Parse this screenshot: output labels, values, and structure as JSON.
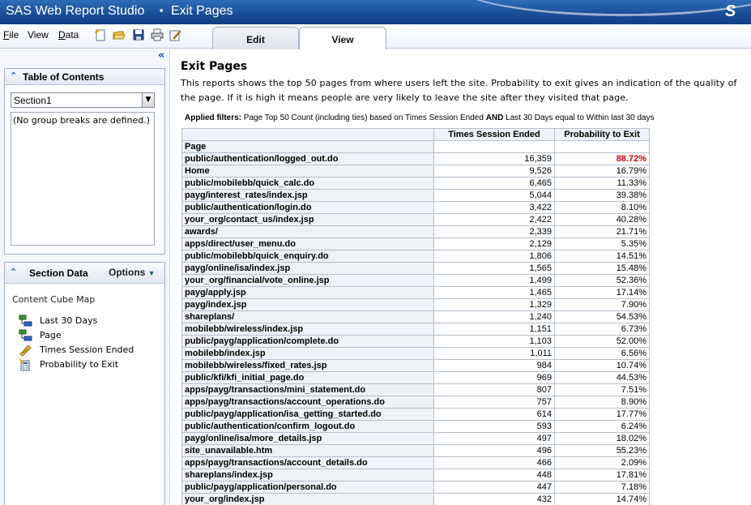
{
  "app": {
    "title": "SAS Web Report Studio",
    "separator": "•",
    "page_name": "Exit Pages",
    "logo": "S"
  },
  "menu": {
    "file_u": "F",
    "file_rest": "ile",
    "view_u": "V",
    "view_rest": "iew",
    "data_u": "D",
    "data_rest": "ata"
  },
  "toolbar_icons": [
    "new-report-icon",
    "open-icon",
    "save-icon",
    "print-icon",
    "edit-properties-icon"
  ],
  "tabs": {
    "edit": "Edit",
    "view": "View"
  },
  "left": {
    "collapse_glyph": "«",
    "toc": {
      "title": "Table of Contents",
      "selected_section": "Section1",
      "empty_message": "(No group breaks are defined.)"
    },
    "section_data": {
      "title": "Section Data",
      "options_label": "Options",
      "cube_map_label": "Content Cube Map",
      "items": [
        {
          "label": "Last 30 Days",
          "icon": "hierarchy-icon"
        },
        {
          "label": "Page",
          "icon": "hierarchy-icon"
        },
        {
          "label": "Times Session Ended",
          "icon": "measure-icon"
        },
        {
          "label": "Probability to Exit",
          "icon": "calculated-measure-icon"
        }
      ]
    }
  },
  "report": {
    "title": "Exit Pages",
    "description": "This reports shows the top 50 pages from where users left the site. Probability to exit gives an indication of the quality of the page. If it is high it means people are very likely to leave the site after they visited that page.",
    "filters": {
      "label": "Applied filters:",
      "text1": "Page Top 50 Count (including ties) based on Times Session Ended",
      "and": "AND",
      "text2": "Last 30 Days equal to Within last 30 days"
    },
    "columns": [
      "Times Session Ended",
      "Probability to Exit"
    ],
    "row_header": "Page",
    "highlight_color": "#cc0000",
    "rows": [
      [
        "public/authentication/logged_out.do",
        "16,359",
        "88.72%"
      ],
      [
        "Home",
        "9,526",
        "16.79%"
      ],
      [
        "public/mobilebb/quick_calc.do",
        "6,465",
        "11.33%"
      ],
      [
        "payg/interest_rates/index.jsp",
        "5,044",
        "39.38%"
      ],
      [
        "public/authentication/login.do",
        "3,422",
        "8.10%"
      ],
      [
        "your_org/contact_us/index.jsp",
        "2,422",
        "40.28%"
      ],
      [
        "awards/",
        "2,339",
        "21.71%"
      ],
      [
        "apps/direct/user_menu.do",
        "2,129",
        "5.35%"
      ],
      [
        "public/mobilebb/quick_enquiry.do",
        "1,806",
        "14.51%"
      ],
      [
        "payg/online/isa/index.jsp",
        "1,565",
        "15.48%"
      ],
      [
        "your_org/financial/vote_online.jsp",
        "1,499",
        "52.36%"
      ],
      [
        "payg/apply.jsp",
        "1,465",
        "17.14%"
      ],
      [
        "payg/index.jsp",
        "1,329",
        "7.90%"
      ],
      [
        "shareplans/",
        "1,240",
        "54.53%"
      ],
      [
        "mobilebb/wireless/index.jsp",
        "1,151",
        "6.73%"
      ],
      [
        "public/payg/application/complete.do",
        "1,103",
        "52.00%"
      ],
      [
        "mobilebb/index.jsp",
        "1,011",
        "6.56%"
      ],
      [
        "mobilebb/wireless/fixed_rates.jsp",
        "984",
        "10.74%"
      ],
      [
        "public/kfi/kfi_initial_page.do",
        "969",
        "44.53%"
      ],
      [
        "apps/payg/transactions/mini_statement.do",
        "807",
        "7.51%"
      ],
      [
        "apps/payg/transactions/account_operations.do",
        "757",
        "8.90%"
      ],
      [
        "public/payg/application/isa_getting_started.do",
        "614",
        "17.77%"
      ],
      [
        "public/authentication/confirm_logout.do",
        "593",
        "6.24%"
      ],
      [
        "payg/online/isa/more_details.jsp",
        "497",
        "18.02%"
      ],
      [
        "site_unavailable.htm",
        "496",
        "55.23%"
      ],
      [
        "apps/payg/transactions/account_details.do",
        "466",
        "2.09%"
      ],
      [
        "shareplans/index.jsp",
        "448",
        "17.81%"
      ],
      [
        "public/payg/application/personal.do",
        "447",
        "7.18%"
      ],
      [
        "your_org/index.jsp",
        "432",
        "14.74%"
      ]
    ]
  }
}
